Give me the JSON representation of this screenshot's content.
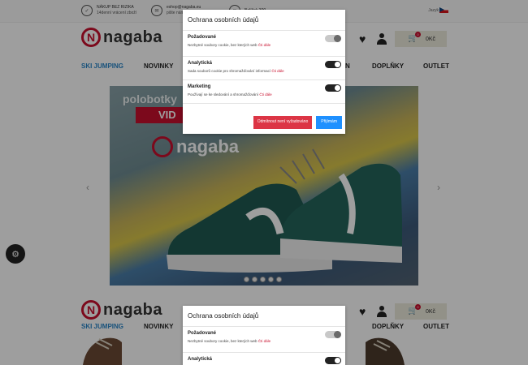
{
  "top": {
    "info1": {
      "title": "NÁKUP BEZ RIZIKA",
      "sub": "14denní vrácení zboží"
    },
    "info2": {
      "title": "eshop@nagaba.eu",
      "sub": "pište nám..."
    },
    "info3": {
      "title": "Balíček 300",
      "sub": ""
    },
    "lang": "Jazyk"
  },
  "header": {
    "logo": "nagaba",
    "cart_label": "0Kč",
    "cart_count": "0"
  },
  "nav": [
    "SKI JUMPING",
    "NOVINKY",
    "N",
    "DOPLŇKY",
    "OUTLET"
  ],
  "hero": {
    "banner": "polobotky",
    "tag": "VID",
    "logo": "nagaba"
  },
  "modal": {
    "title": "Ochrana osobních údajů",
    "rows": [
      {
        "title": "Požadované",
        "desc": "Nezbytné soubory cookie, bez kterých web",
        "link": "Čti dále"
      },
      {
        "title": "Analytická",
        "desc": "Sada souborů cookie pro shromažďování informací",
        "link": "Čti dále"
      },
      {
        "title": "Marketing",
        "desc": "Používají se ke sledování a shromažďování",
        "link": "Čti dále"
      }
    ],
    "reject": "Odmítnout není vyžadováno",
    "accept": "Přijímám"
  }
}
